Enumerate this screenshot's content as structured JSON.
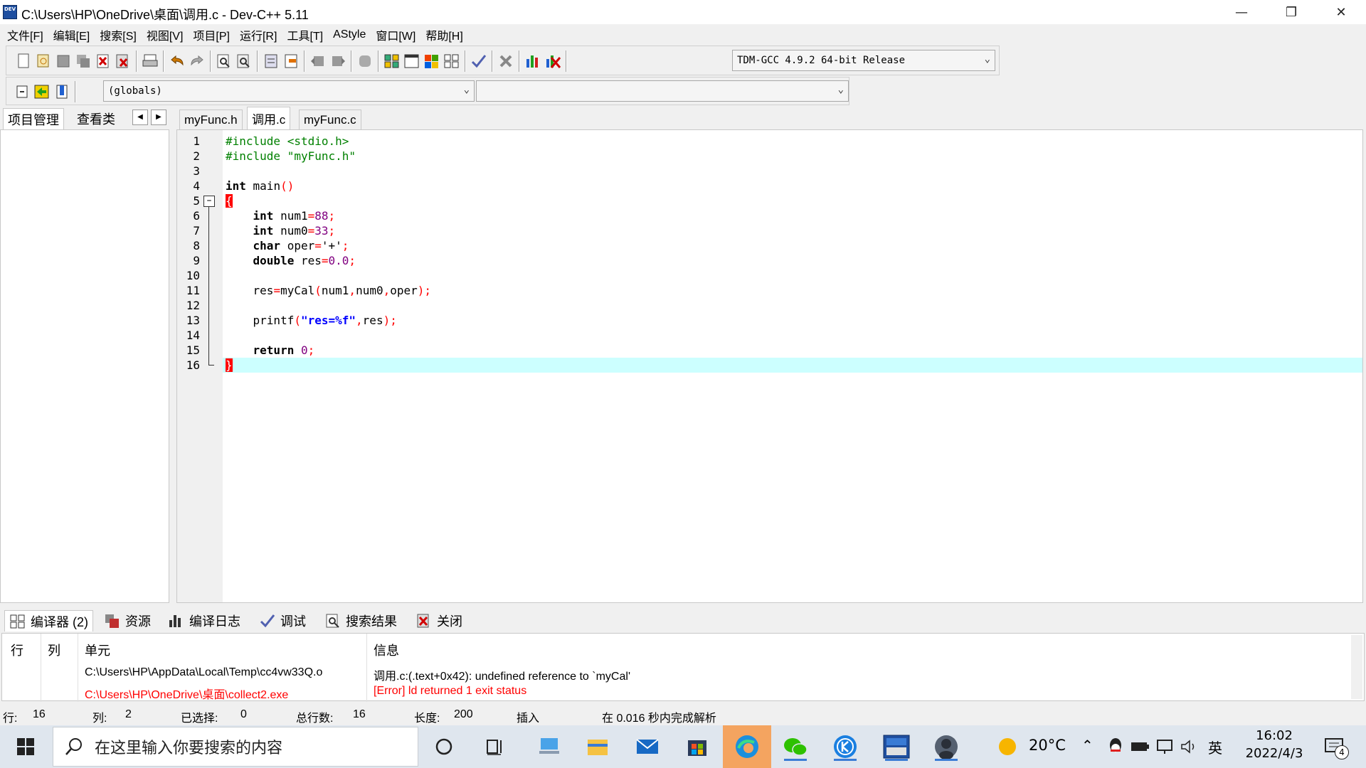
{
  "window": {
    "title": "C:\\Users\\HP\\OneDrive\\桌面\\调用.c - Dev-C++ 5.11",
    "icon_text": "DEV"
  },
  "menu": [
    "文件[F]",
    "编辑[E]",
    "搜索[S]",
    "视图[V]",
    "项目[P]",
    "运行[R]",
    "工具[T]",
    "AStyle",
    "窗口[W]",
    "帮助[H]"
  ],
  "toolbar": {
    "compiler": "TDM-GCC 4.9.2 64-bit Release",
    "scope": "(globals)",
    "function": ""
  },
  "left_tabs": [
    "项目管理",
    "查看类"
  ],
  "editor_tabs": [
    "myFunc.h",
    "调用.c",
    "myFunc.c"
  ],
  "code_lines": [
    {
      "n": "1"
    },
    {
      "n": "2"
    },
    {
      "n": "3"
    },
    {
      "n": "4"
    },
    {
      "n": "5"
    },
    {
      "n": "6"
    },
    {
      "n": "7"
    },
    {
      "n": "8"
    },
    {
      "n": "9"
    },
    {
      "n": "10"
    },
    {
      "n": "11"
    },
    {
      "n": "12"
    },
    {
      "n": "13"
    },
    {
      "n": "14"
    },
    {
      "n": "15"
    },
    {
      "n": "16"
    }
  ],
  "code": {
    "l1": "#include <stdio.h>",
    "l2": "#include \"myFunc.h\"",
    "l4_kw": "int",
    "l4_rest": " main",
    "l4_paren": "()",
    "l5": "{",
    "l6_kw": "int",
    "l6_name": " num1",
    "l6_eq": "=",
    "l6_val": "88",
    "l6_end": ";",
    "l7_kw": "int",
    "l7_name": " num0",
    "l7_eq": "=",
    "l7_val": "33",
    "l7_end": ";",
    "l8_kw": "char",
    "l8_name": " oper",
    "l8_eq": "=",
    "l8_val": "'+'",
    "l8_end": ";",
    "l9_kw": "double",
    "l9_name": " res",
    "l9_eq": "=",
    "l9_val": "0.0",
    "l9_end": ";",
    "l11_a": "res",
    "l11_eq": "=",
    "l11_b": "myCal",
    "l11_p1": "(",
    "l11_c": "num1",
    "l11_cm1": ",",
    "l11_d": "num0",
    "l11_cm2": ",",
    "l11_e": "oper",
    "l11_p2": ");",
    "l13_a": "printf",
    "l13_p1": "(",
    "l13_s": "\"res=%f\"",
    "l13_cm": ",",
    "l13_b": "res",
    "l13_p2": ");",
    "l15_kw": "return",
    "l15_sp": " ",
    "l15_val": "0",
    "l15_end": ";",
    "l16": "}"
  },
  "bottom_tabs": [
    {
      "label": "编译器 (2)",
      "icon": "compiler-grid-icon"
    },
    {
      "label": "资源",
      "icon": "resources-icon"
    },
    {
      "label": "编译日志",
      "icon": "bar-chart-icon"
    },
    {
      "label": "调试",
      "icon": "checkmark-icon"
    },
    {
      "label": "搜索结果",
      "icon": "search-doc-icon"
    },
    {
      "label": "关闭",
      "icon": "close-doc-icon"
    }
  ],
  "results": {
    "headers": [
      "行",
      "列",
      "单元",
      "信息"
    ],
    "rows": [
      {
        "unit": "C:\\Users\\HP\\AppData\\Local\\Temp\\cc4vw33Q.o",
        "message": "调用.c:(.text+0x42): undefined reference to `myCal'"
      },
      {
        "unit": "C:\\Users\\HP\\OneDrive\\桌面\\collect2.exe",
        "message": "[Error] ld returned 1 exit status"
      }
    ]
  },
  "status": {
    "row_label": "行:",
    "row_val": "16",
    "col_label": "列:",
    "col_val": "2",
    "sel_label": "已选择:",
    "sel_val": "0",
    "total_label": "总行数:",
    "total_val": "16",
    "len_label": "长度:",
    "len_val": "200",
    "mode": "插入",
    "parse": "在 0.016 秒内完成解析"
  },
  "taskbar": {
    "search_placeholder": "在这里输入你要搜索的内容",
    "weather": "20°C",
    "ime": "英",
    "time": "16:02",
    "date": "2022/4/3",
    "notifications": "4"
  },
  "colors": {
    "current_line": "#ccffff",
    "error_text": "#ff0000",
    "brace_highlight": "#ff0000",
    "preprocessor": "#008000",
    "number": "#800080",
    "string": "#0000ff"
  }
}
